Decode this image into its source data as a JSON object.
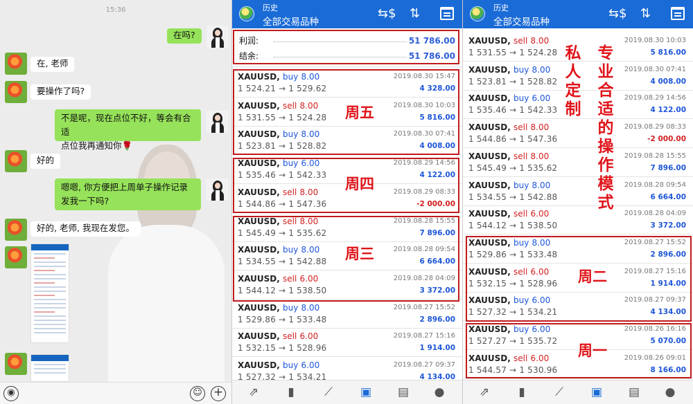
{
  "chat": {
    "timestamp": "15:36",
    "messages": [
      {
        "side": "right",
        "text": "在吗?"
      },
      {
        "side": "left",
        "text": "在, 老师"
      },
      {
        "side": "left",
        "text": "要操作了吗?"
      },
      {
        "side": "right",
        "line1": "不是呢，现在点位不好，等会有合适",
        "line2": "点位我再通知你🌹"
      },
      {
        "side": "left",
        "text": "好的"
      },
      {
        "side": "right",
        "line1": "嗯嗯, 你方便把上周单子操作记录",
        "line2": "发我一下吗?"
      },
      {
        "side": "left",
        "text": "好的, 老师, 我现在发您。"
      }
    ],
    "input_icons": [
      "voice-icon",
      "emoji-icon",
      "plus-icon"
    ]
  },
  "app": {
    "title_small": "历史",
    "title_main": "全部交易品种",
    "toolbar_icons": [
      "currency-exchange-icon",
      "sort-icon",
      "calendar-icon"
    ],
    "nav_icons": [
      "trade-icon",
      "candles-icon",
      "chart-icon",
      "history-icon",
      "news-icon",
      "chat-icon"
    ],
    "accent_color": "#1a6bd6"
  },
  "panel1": {
    "summary": {
      "profit_label": "利润:",
      "profit_value": "51 786.00",
      "balance_label": "结余:",
      "balance_value": "51 786.00"
    },
    "trades": [
      {
        "symbol": "XAUUSD,",
        "side": "buy",
        "volume": "8.00",
        "prices": "1 524.21 → 1 529.62",
        "time": "2019.08.30 15:47",
        "pl": "4 328.00"
      },
      {
        "symbol": "XAUUSD,",
        "side": "sell",
        "volume": "8.00",
        "prices": "1 531.55 → 1 524.28",
        "time": "2019.08.30 10:03",
        "pl": "5 816.00"
      },
      {
        "symbol": "XAUUSD,",
        "side": "buy",
        "volume": "8.00",
        "prices": "1 523.81 → 1 528.82",
        "time": "2019.08.30 07:41",
        "pl": "4 008.00"
      },
      {
        "symbol": "XAUUSD,",
        "side": "buy",
        "volume": "6.00",
        "prices": "1 535.46 → 1 542.33",
        "time": "2019.08.29 14:56",
        "pl": "4 122.00"
      },
      {
        "symbol": "XAUUSD,",
        "side": "sell",
        "volume": "8.00",
        "prices": "1 544.86 → 1 547.36",
        "time": "2019.08.29 08:33",
        "pl": "-2 000.00"
      },
      {
        "symbol": "XAUUSD,",
        "side": "sell",
        "volume": "8.00",
        "prices": "1 545.49 → 1 535.62",
        "time": "2019.08.28 15:55",
        "pl": "7 896.00"
      },
      {
        "symbol": "XAUUSD,",
        "side": "buy",
        "volume": "8.00",
        "prices": "1 534.55 → 1 542.88",
        "time": "2019.08.28 09:54",
        "pl": "6 664.00"
      },
      {
        "symbol": "XAUUSD,",
        "side": "sell",
        "volume": "6.00",
        "prices": "1 544.12 → 1 538.50",
        "time": "2019.08.28 04:09",
        "pl": "3 372.00"
      },
      {
        "symbol": "XAUUSD,",
        "side": "buy",
        "volume": "8.00",
        "prices": "1 529.86 → 1 533.48",
        "time": "2019.08.27 15:52",
        "pl": "2 896.00"
      },
      {
        "symbol": "XAUUSD,",
        "side": "sell",
        "volume": "6.00",
        "prices": "1 532.15 → 1 528.96",
        "time": "2019.08.27 15:16",
        "pl": "1 914.00"
      },
      {
        "symbol": "XAUUSD,",
        "side": "buy",
        "volume": "6.00",
        "prices": "1 527.32 → 1 534.21",
        "time": "2019.08.27 09:37",
        "pl": "4 134.00"
      }
    ],
    "annotations": {
      "fri": "周五",
      "thu": "周四",
      "wed": "周三"
    }
  },
  "panel2": {
    "trades": [
      {
        "symbol": "XAUUSD,",
        "side": "sell",
        "volume": "8.00",
        "prices": "1 531.55 → 1 524.28",
        "time": "2019.08.30 10:03",
        "pl": "5 816.00"
      },
      {
        "symbol": "XAUUSD,",
        "side": "buy",
        "volume": "8.00",
        "prices": "1 523.81 → 1 528.82",
        "time": "2019.08.30 07:41",
        "pl": "4 008.00"
      },
      {
        "symbol": "XAUUSD,",
        "side": "buy",
        "volume": "6.00",
        "prices": "1 535.46 → 1 542.33",
        "time": "2019.08.29 14:56",
        "pl": "4 122.00"
      },
      {
        "symbol": "XAUUSD,",
        "side": "sell",
        "volume": "8.00",
        "prices": "1 544.86 → 1 547.36",
        "time": "2019.08.29 08:33",
        "pl": "-2 000.00"
      },
      {
        "symbol": "XAUUSD,",
        "side": "sell",
        "volume": "8.00",
        "prices": "1 545.49 → 1 535.62",
        "time": "2019.08.28 15:55",
        "pl": "7 896.00"
      },
      {
        "symbol": "XAUUSD,",
        "side": "buy",
        "volume": "8.00",
        "prices": "1 534.55 → 1 542.88",
        "time": "2019.08.28 09:54",
        "pl": "6 664.00"
      },
      {
        "symbol": "XAUUSD,",
        "side": "sell",
        "volume": "6.00",
        "prices": "1 544.12 → 1 538.50",
        "time": "2019.08.28 04:09",
        "pl": "3 372.00"
      },
      {
        "symbol": "XAUUSD,",
        "side": "buy",
        "volume": "8.00",
        "prices": "1 529.86 → 1 533.48",
        "time": "2019.08.27 15:52",
        "pl": "2 896.00"
      },
      {
        "symbol": "XAUUSD,",
        "side": "sell",
        "volume": "6.00",
        "prices": "1 532.15 → 1 528.96",
        "time": "2019.08.27 15:16",
        "pl": "1 914.00"
      },
      {
        "symbol": "XAUUSD,",
        "side": "buy",
        "volume": "6.00",
        "prices": "1 527.32 → 1 534.21",
        "time": "2019.08.27 09:37",
        "pl": "4 134.00"
      },
      {
        "symbol": "XAUUSD,",
        "side": "buy",
        "volume": "6.00",
        "prices": "1 527.27 → 1 535.72",
        "time": "2019.08.26 16:16",
        "pl": "5 070.00"
      },
      {
        "symbol": "XAUUSD,",
        "side": "sell",
        "volume": "6.00",
        "prices": "1 544.57 → 1 530.96",
        "time": "2019.08.26 09:01",
        "pl": "8 166.00"
      }
    ],
    "annotations": {
      "private": "私人定制",
      "mode": "专业合适的操作模式",
      "tue": "周二",
      "mon": "周一"
    }
  }
}
